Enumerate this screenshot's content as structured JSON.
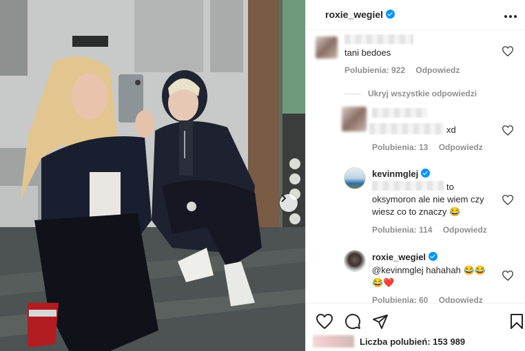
{
  "post": {
    "author": "roxie_wegiel",
    "more_icon": "more-horizontal-icon"
  },
  "comments": [
    {
      "user_blurred": true,
      "text": "tani bedoes",
      "likes": "Polubienia: 922",
      "reply": "Odpowiedz"
    },
    {
      "toggle": "Ukryj wszystkie odpowiedzi"
    },
    {
      "user_blurred": true,
      "text": "xd",
      "likes": "Polubienia: 13",
      "reply": "Odpowiedz"
    },
    {
      "user": "kevinmglej",
      "verified": true,
      "text_line1": "to",
      "text_line2": "oksymoron ale nie wiem czy",
      "text_line3": "wiesz co to znaczy 😂",
      "likes": "Polubienia: 114",
      "reply": "Odpowiedz"
    },
    {
      "user": "roxie_wegiel",
      "verified": true,
      "text_line1": "@kevinmglej hahahah 😂😂",
      "text_line2": "😂❤️",
      "likes": "Polubienia: 60",
      "reply": "Odpowiedz"
    }
  ],
  "actions": {
    "like_icon": "heart-icon",
    "comment_icon": "comment-icon",
    "share_icon": "send-icon",
    "save_icon": "bookmark-icon"
  },
  "likes_summary": "Liczba polubień: 153 989",
  "colors": {
    "verified": "#0095f6",
    "muted": "#8e8e8e",
    "text": "#262626"
  }
}
